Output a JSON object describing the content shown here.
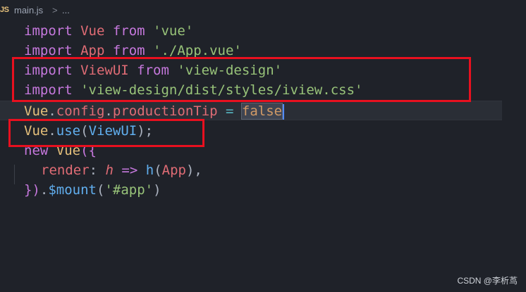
{
  "breadcrumb": {
    "badge": "JS",
    "file": "main.js",
    "separator": ">",
    "more": "..."
  },
  "code": {
    "l1": {
      "kw1": "import",
      "id": " Vue",
      "kw2": " from",
      "str": " 'vue'"
    },
    "l2": {
      "kw1": "import",
      "id": " App",
      "kw2": " from",
      "str": " './App.vue'"
    },
    "l3": {
      "kw1": "import",
      "id": " ViewUI",
      "kw2": " from",
      "str": " 'view-design'"
    },
    "l4": {
      "kw1": "import",
      "str": " 'view-design/dist/styles/iview.css'"
    },
    "l5": {
      "obj": "Vue",
      "dot1": ".",
      "p1": "config",
      "dot2": ".",
      "p2": "productionTip",
      "eq": " = ",
      "val": "false"
    },
    "l6": {
      "obj": "Vue",
      "dot": ".",
      "fn": "use",
      "open": "(",
      "arg": "ViewUI",
      "close": ");"
    },
    "l7": {
      "kw": "new",
      "cls": " Vue",
      "open": "({"
    },
    "l8": {
      "key": "render",
      "colon": ": ",
      "param": "h",
      "arrow": " => ",
      "fn": "h",
      "open": "(",
      "arg": "App",
      "close": "),"
    },
    "l9": {
      "close": "})",
      "dot": ".",
      "fn": "$mount",
      "open": "(",
      "str": "'#app'",
      "close2": ")"
    }
  },
  "watermark": "CSDN @李析茑",
  "colors": {
    "keyword": "#c678dd",
    "identifier": "#e06c75",
    "string": "#98c379",
    "property": "#e5c07b",
    "function": "#61afef",
    "highlight_box": "#e8101f",
    "background": "#1f2229"
  }
}
